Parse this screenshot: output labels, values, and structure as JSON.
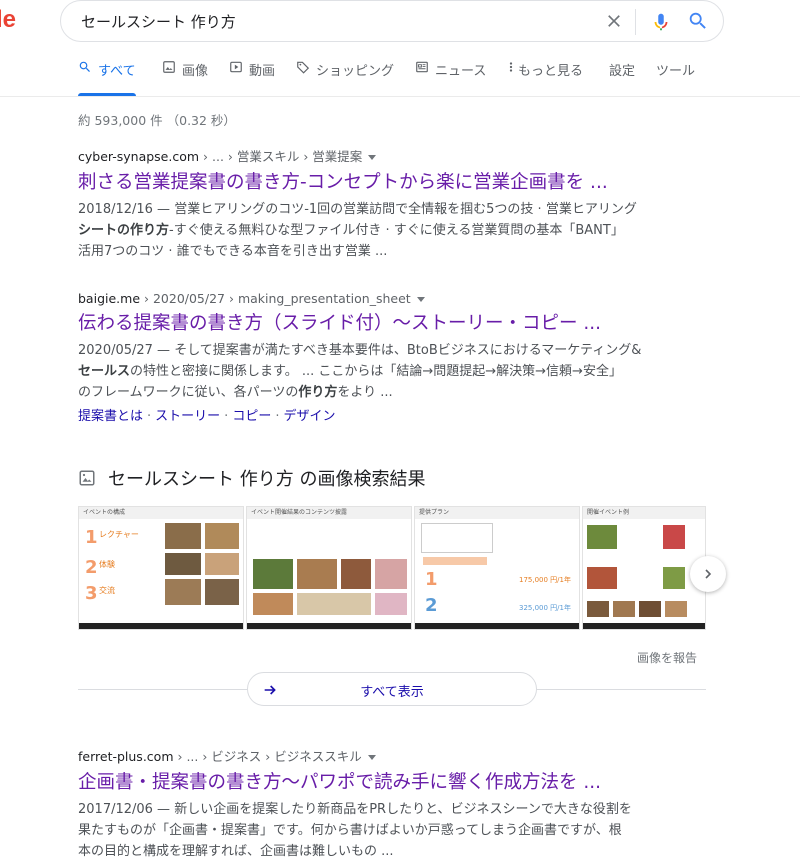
{
  "logo_fragment": "le",
  "search": {
    "query": "セールスシート 作り方"
  },
  "tabs": [
    {
      "label": "すべて",
      "icon": "search-icon"
    },
    {
      "label": "画像",
      "icon": "image-icon"
    },
    {
      "label": "動画",
      "icon": "video-icon"
    },
    {
      "label": "ショッピング",
      "icon": "tag-icon"
    },
    {
      "label": "ニュース",
      "icon": "news-icon"
    },
    {
      "label": "もっと見る",
      "icon": "more-vert-icon"
    },
    {
      "label": "設定"
    },
    {
      "label": "ツール"
    }
  ],
  "stats": "約 593,000 件 （0.32 秒）",
  "results": [
    {
      "domain": "cyber-synapse.com",
      "path": " › ... › 営業スキル › 営業提案",
      "title": "刺さる営業提案書の書き方-コンセプトから楽に営業企画書を ...",
      "snippet_parts": [
        "2018/12/16 — 営業ヒアリングのコツ-1回の営業訪問で全情報を掴む5つの技 · 営業ヒアリング",
        "シートの",
        "作り方",
        "-すぐ使える無料ひな型ファイル付き · すぐに使える営業質問の基本「BANT」",
        "活用7つのコツ · 誰でもできる本音を引き出す営業 ..."
      ]
    },
    {
      "domain": "baigie.me",
      "path": " › 2020/05/27 › making_presentation_sheet",
      "title": "伝わる提案書の書き方（スライド付）～ストーリー・コピー ...",
      "snippet_parts": [
        "2020/05/27 — そして提案書が満たすべき基本要件は、BtoBビジネスにおけるマーケティング&",
        "セールス",
        "の特性と密接に関係します。 ... ここからは「結論→問題提起→解決策→信頼→安全」",
        "のフレームワークに従い、各パーツの",
        "作り方",
        "をより ..."
      ],
      "sitelinks": [
        "提案書とは",
        "ストーリー",
        "コピー",
        "デザイン"
      ]
    },
    {
      "domain": "ferret-plus.com",
      "path": " › ... › ビジネス › ビジネススキル",
      "title": "企画書・提案書の書き方～パワポで読み手に響く作成方法を ...",
      "snippet_parts": [
        "2017/12/06 — 新しい企画を提案したり新商品をPRしたりと、ビジネスシーンで大きな役割を",
        "果たすものが「企画書・提案書」です。何から書けばよいか戸惑ってしまう企画書ですが、根",
        "本の目的と構成を理解すれば、企画書は難しいもの ..."
      ]
    }
  ],
  "images": {
    "heading": "セールスシート 作り方 の画像検索結果",
    "thumbs": [
      {
        "caption": "イベントの構成",
        "items": [
          "レクチャー",
          "体験",
          "交流"
        ]
      },
      {
        "caption": "イベント開催結果のコンテンツ披露"
      },
      {
        "caption": "提供プラン",
        "prices": [
          "175,000 円/1年",
          "325,000 円/1年"
        ]
      },
      {
        "caption": "開催イベント例"
      }
    ],
    "report": "画像を報告",
    "show_all": "すべて表示"
  },
  "colors": {
    "accent": "#1a73e8",
    "visited": "#681da8",
    "link": "#1a0dab",
    "logo_red": "#ea4335"
  }
}
